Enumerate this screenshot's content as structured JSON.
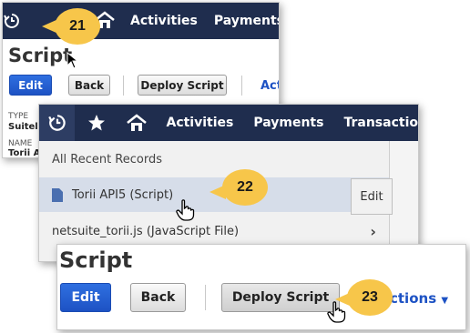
{
  "callouts": {
    "c21": "21",
    "c22": "22",
    "c23": "23"
  },
  "panel1": {
    "nav": {
      "activities": "Activities",
      "payments": "Payments"
    },
    "title": "Script",
    "edit_label": "Edit",
    "back_label": "Back",
    "deploy_label": "Deploy Script",
    "actions_partial": "Act",
    "type_label": "TYPE",
    "type_value": "Suitele",
    "name_label": "NAME",
    "name_value": "Torii A"
  },
  "panel2": {
    "nav": {
      "activities": "Activities",
      "payments": "Payments",
      "transactions": "Transactio"
    },
    "menu_header": "All Recent Records",
    "records": [
      {
        "label": "Torii API5 (Script)"
      },
      {
        "label": "netsuite_torii.js (JavaScript File)"
      }
    ],
    "edit_label": "Edit"
  },
  "panel3": {
    "title": "Script",
    "edit_label": "Edit",
    "back_label": "Back",
    "deploy_label": "Deploy Script",
    "actions_label": "ctions"
  },
  "colors": {
    "nav": "#1f2d4e",
    "accent": "#2f6fe0",
    "callout": "#f7c64a"
  }
}
